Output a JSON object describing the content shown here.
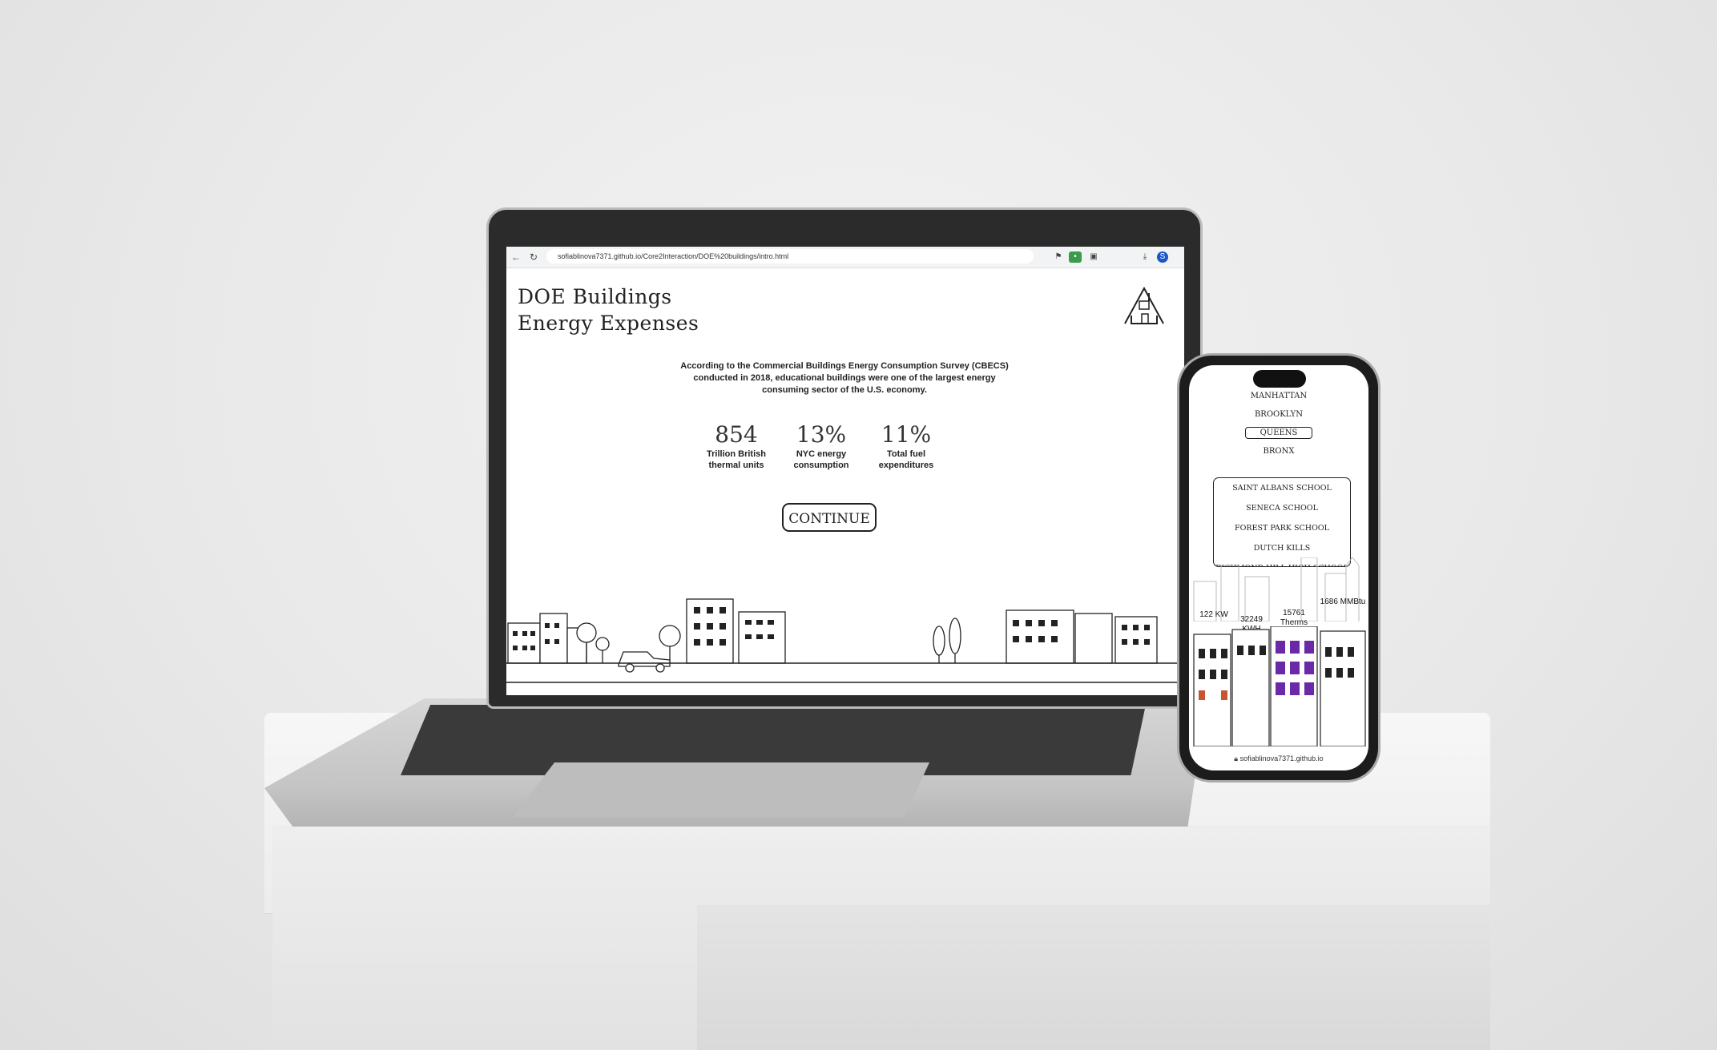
{
  "browser": {
    "url": "sofiablinova7371.github.io/Core2Interaction/DOE%20buildings/intro.html",
    "profile_initial": "S"
  },
  "page": {
    "title_line1": "DOE Buildings",
    "title_line2": "Energy Expenses",
    "intro": "According to the Commercial Buildings Energy Consumption Survey (CBECS) conducted in 2018, educational buildings were one of the largest energy consuming sector of the U.S. economy.",
    "stats": [
      {
        "value": "854",
        "label": "Trillion British thermal units"
      },
      {
        "value": "13%",
        "label": "NYC energy consumption"
      },
      {
        "value": "11%",
        "label": "Total fuel expenditures"
      }
    ],
    "continue_label": "CONTINUE"
  },
  "phone": {
    "boroughs": [
      "MANHATTAN",
      "BROOKLYN",
      "QUEENS",
      "BRONX"
    ],
    "selected_borough": "QUEENS",
    "schools": [
      "SAINT ALBANS SCHOOL",
      "SENECA SCHOOL",
      "FOREST PARK SCHOOL",
      "DUTCH KILLS",
      "RICHMOND HILL HIGH SCHOOL"
    ],
    "values": [
      "122 KW",
      "32249 KWH",
      "15761 Therms",
      "1686 MMBtu"
    ],
    "url": "sofiablinova7371.github.io"
  },
  "colors": {
    "accent_purple": "#6a2aa8",
    "text": "#222222"
  }
}
